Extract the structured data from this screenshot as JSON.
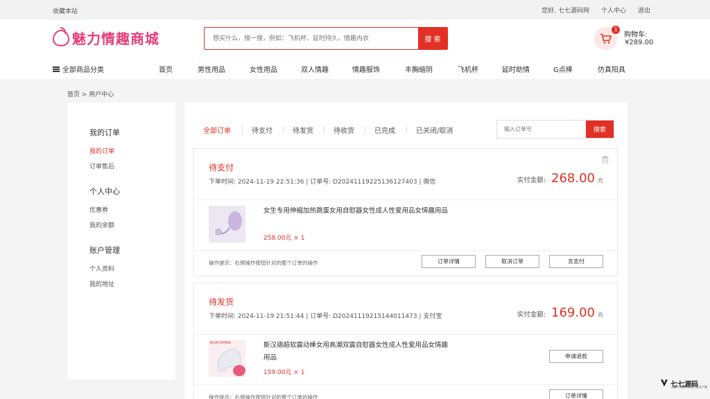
{
  "topbar": {
    "favorite": "收藏本站",
    "greeting": "您好, 七七源码网",
    "personal_center": "个人中心",
    "logout": "退出"
  },
  "logo": {
    "text": "魅力情趣商城",
    "icon": "peach-icon",
    "color": "#e83e7a"
  },
  "search": {
    "placeholder": "想买什么，搜一搜，例如：飞机杯、延时持久、情趣内衣",
    "button": "搜 索"
  },
  "cart": {
    "badge": "1",
    "label": "购物车:",
    "total": "¥289.00",
    "icon": "cart-icon"
  },
  "nav": {
    "all_categories": "全部商品分类",
    "items": [
      "首页",
      "男性用品",
      "女性用品",
      "双人情趣",
      "情趣服饰",
      "丰胸缩阴",
      "飞机杯",
      "延时助情",
      "G点棒",
      "仿真阳具"
    ]
  },
  "breadcrumb": "首页 > 用户中心",
  "sidebar": {
    "sections": [
      {
        "title": "我的订单",
        "items": [
          "我的订单",
          "订单售后"
        ]
      },
      {
        "title": "个人中心",
        "items": [
          "优惠券",
          "我的余额"
        ]
      },
      {
        "title": "账户管理",
        "items": [
          "个人资料",
          "我的地址"
        ]
      }
    ],
    "active": "我的订单"
  },
  "tabs": [
    "全部订单",
    "待支付",
    "待发货",
    "待收货",
    "已完成",
    "已关闭/取消"
  ],
  "active_tab": "全部订单",
  "order_search": {
    "placeholder": "输入订单号",
    "button": "搜索"
  },
  "orders": [
    {
      "status": "待支付",
      "meta": "下单时间:  2024-11-19 22:51:36 | 订单号:   D20241119225136127403 | 微信",
      "paid_label": "实付金额:",
      "amount": "268.00",
      "currency": "元",
      "product_name": "女生专用伸缩加热跳蛋女用自慰器女性成人性爱用品女情趣用品",
      "product_price": "258.00元 × 1",
      "tip": "操作提示：右侧操作按钮针对的整个订单的操作",
      "actions": [
        "订单详情",
        "取消订单",
        "去支付"
      ]
    },
    {
      "status": "待发货",
      "meta": "下单时间:  2024-11-19 21:51:44 | 订单号:   D20241119215144011473 | 支付宝",
      "paid_label": "实付金额:",
      "amount": "169.00",
      "currency": "元",
      "product_name": "斯汉德超软震动棒女用高潮双震自慰器女性成人性爱用品女情趣用品",
      "product_price": "159.00元 × 1",
      "thumb_text": "斯汉德·SHANDE",
      "action_top": "申请退款",
      "tip": "操作提示：右侧操作按钮针对的整个订单的操作",
      "action_bottom": "订单详情"
    }
  ],
  "watermark": {
    "title": "七七源码",
    "sub": "正版七七源码网提供全站下载"
  },
  "colors": {
    "accent": "#e33025",
    "logo": "#e83e7a"
  }
}
